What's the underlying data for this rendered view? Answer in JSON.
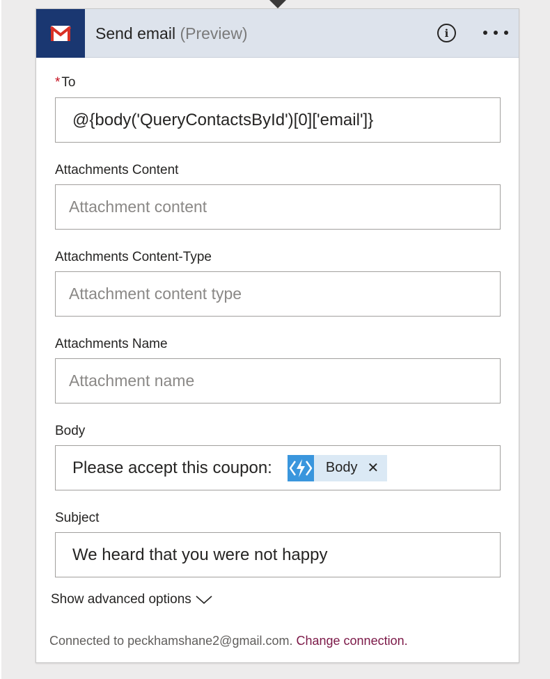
{
  "header": {
    "title": "Send email",
    "suffix": "(Preview)",
    "app_icon": "gmail-icon",
    "info_icon": "info-icon",
    "more_icon": "more-options-icon",
    "accent_color": "#1a3771"
  },
  "fields": {
    "to": {
      "required_mark": "*",
      "label": "To",
      "value": "@{body('QueryContactsById')[0]['email']}"
    },
    "attachments_content": {
      "label": "Attachments Content",
      "placeholder": "Attachment content"
    },
    "attachments_content_type": {
      "label": "Attachments Content-Type",
      "placeholder": "Attachment content type"
    },
    "attachments_name": {
      "label": "Attachments Name",
      "placeholder": "Attachment name"
    },
    "body": {
      "label": "Body",
      "text": "Please accept this coupon:",
      "token": {
        "label": "Body",
        "remove": "✕",
        "icon": "azure-function-icon",
        "color": "#3a96dd"
      }
    },
    "subject": {
      "label": "Subject",
      "value": "We heard that you were not happy"
    }
  },
  "advanced": {
    "label": "Show advanced options",
    "icon": "chevron-down-icon"
  },
  "footer": {
    "connected_text": "Connected to peckhamshane2@gmail.com.",
    "change_link": "Change connection."
  }
}
